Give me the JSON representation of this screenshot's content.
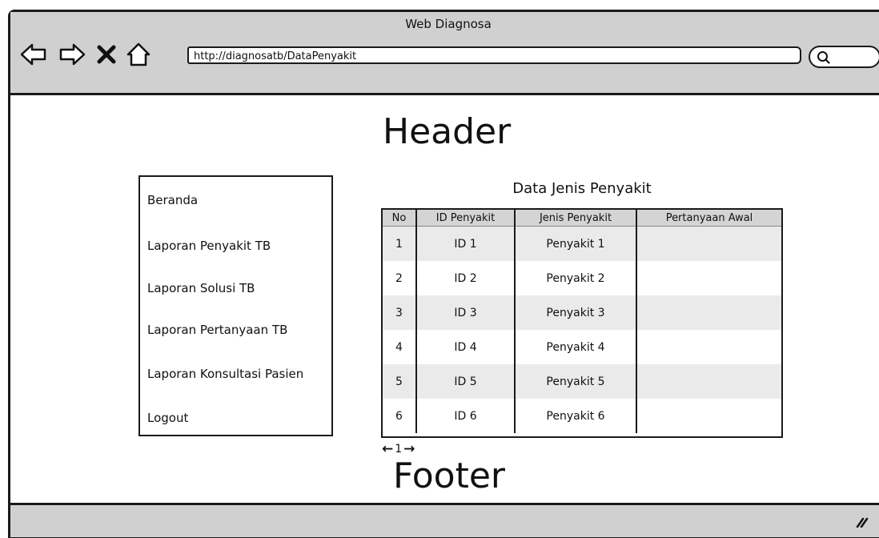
{
  "window": {
    "title": "Web Diagnosa",
    "url": "http://diagnosatb/DataPenyakit"
  },
  "icons": {
    "back": "back-arrow-icon",
    "forward": "forward-arrow-icon",
    "stop": "close-icon",
    "home": "home-icon",
    "search": "search-icon",
    "resize": "resize-grip-icon"
  },
  "page": {
    "header": "Header",
    "footer": "Footer"
  },
  "sidebar": {
    "items": [
      {
        "label": "Beranda"
      },
      {
        "label": "Laporan Penyakit TB"
      },
      {
        "label": "Laporan Solusi TB"
      },
      {
        "label": "Laporan Pertanyaan TB"
      },
      {
        "label": "Laporan Konsultasi Pasien"
      },
      {
        "label": "Logout"
      }
    ]
  },
  "table": {
    "title": "Data Jenis Penyakit",
    "columns": [
      "No",
      "ID Penyakit",
      "Jenis Penyakit",
      "Pertanyaan Awal"
    ],
    "rows": [
      [
        "1",
        "ID 1",
        "Penyakit 1",
        ""
      ],
      [
        "2",
        "ID 2",
        "Penyakit 2",
        ""
      ],
      [
        "3",
        "ID 3",
        "Penyakit 3",
        ""
      ],
      [
        "4",
        "ID 4",
        "Penyakit 4",
        ""
      ],
      [
        "5",
        "ID 5",
        "Penyakit 5",
        ""
      ],
      [
        "6",
        "ID 6",
        "Penyakit 6",
        ""
      ]
    ]
  },
  "pagination": {
    "prev": "←",
    "page": "1",
    "next": "→"
  },
  "colors": {
    "chrome": "#d0d0d0",
    "border": "#1a1a1a",
    "row_alt": "#eaeaea",
    "header_row": "#d4d4d4"
  }
}
